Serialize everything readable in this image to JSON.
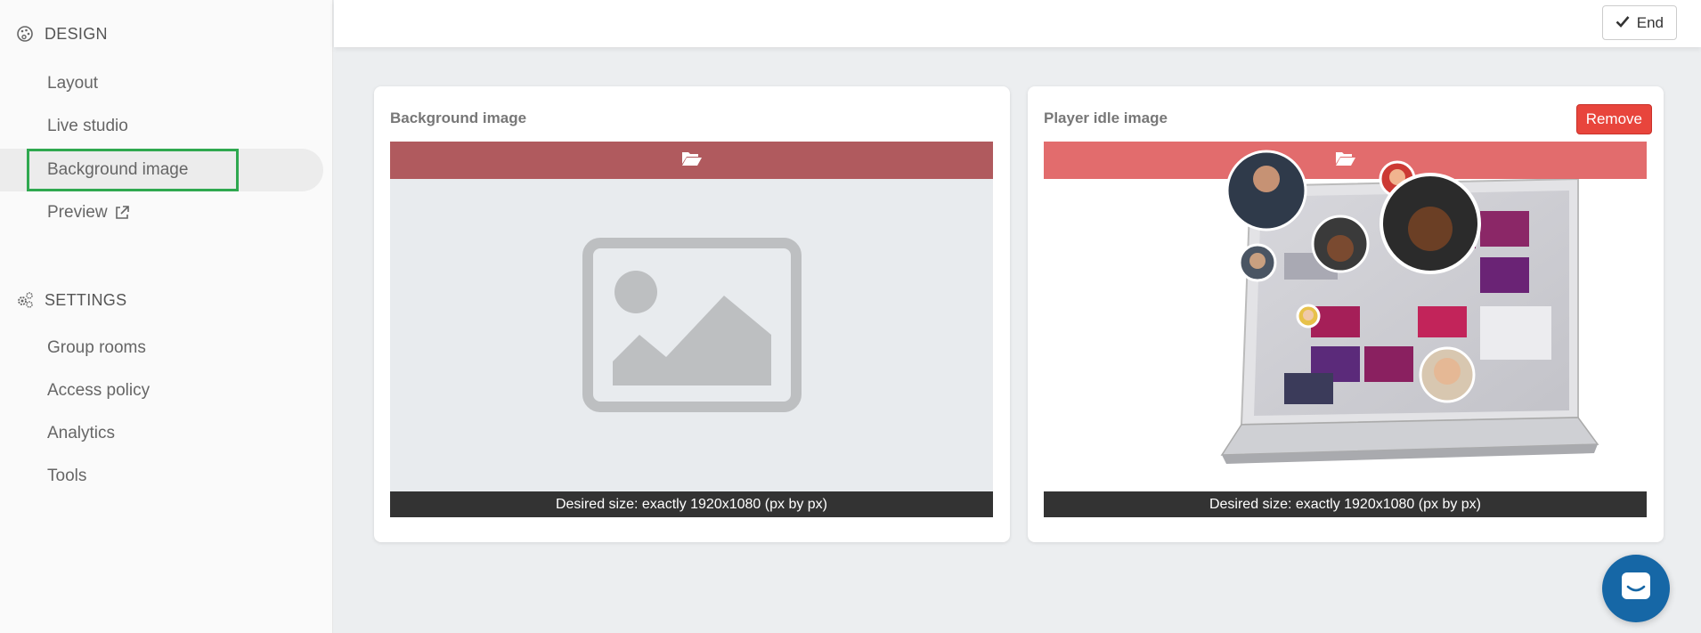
{
  "sidebar": {
    "design_heading": "DESIGN",
    "design_items": [
      {
        "label": "Layout"
      },
      {
        "label": "Live studio"
      },
      {
        "label": "Background image"
      },
      {
        "label": "Preview"
      }
    ],
    "settings_heading": "SETTINGS",
    "settings_items": [
      {
        "label": "Group rooms"
      },
      {
        "label": "Access policy"
      },
      {
        "label": "Analytics"
      },
      {
        "label": "Tools"
      }
    ]
  },
  "toolbar": {
    "end_label": "End"
  },
  "cards": [
    {
      "title": "Background image",
      "upload_icon": "folder-open-icon",
      "size_hint": "Desired size: exactly 1920x1080 (px by px)"
    },
    {
      "title": "Player idle image",
      "remove_label": "Remove",
      "upload_icon": "folder-open-icon",
      "size_hint": "Desired size: exactly 1920x1080 (px by px)"
    }
  ],
  "colors": {
    "accent_highlight": "#2fa84f",
    "remove_red": "#e8453c",
    "upload_bar_dark": "#b05a5e",
    "upload_bar_light": "#e06465",
    "chat_blue": "#1667a6"
  }
}
